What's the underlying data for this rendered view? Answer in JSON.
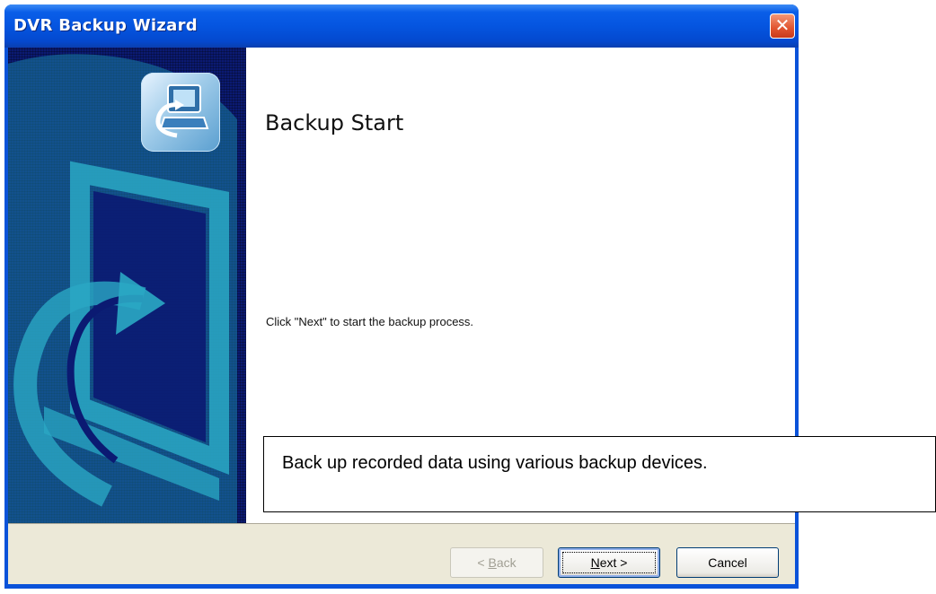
{
  "window": {
    "title": "DVR Backup Wizard",
    "close_symbol": "✕"
  },
  "page": {
    "heading": "Backup Start",
    "instruction": "Click \"Next\" to start the backup process."
  },
  "buttons": {
    "back": {
      "prefix": "< ",
      "mnemonic": "B",
      "rest": "ack"
    },
    "next": {
      "mnemonic": "N",
      "rest": "ext >"
    },
    "cancel": "Cancel"
  },
  "callout": {
    "text": "Back up recorded data using various backup devices."
  },
  "icons": [
    "close-icon",
    "backup-wizard-icon",
    "computer-arrow-graphic"
  ],
  "colors": {
    "titlebar": "#0555e0",
    "sidebar": "#0b1a72",
    "sidebar_pattern": "#2aa8c4",
    "footer": "#ece9d8",
    "close_button": "#e1542f"
  }
}
